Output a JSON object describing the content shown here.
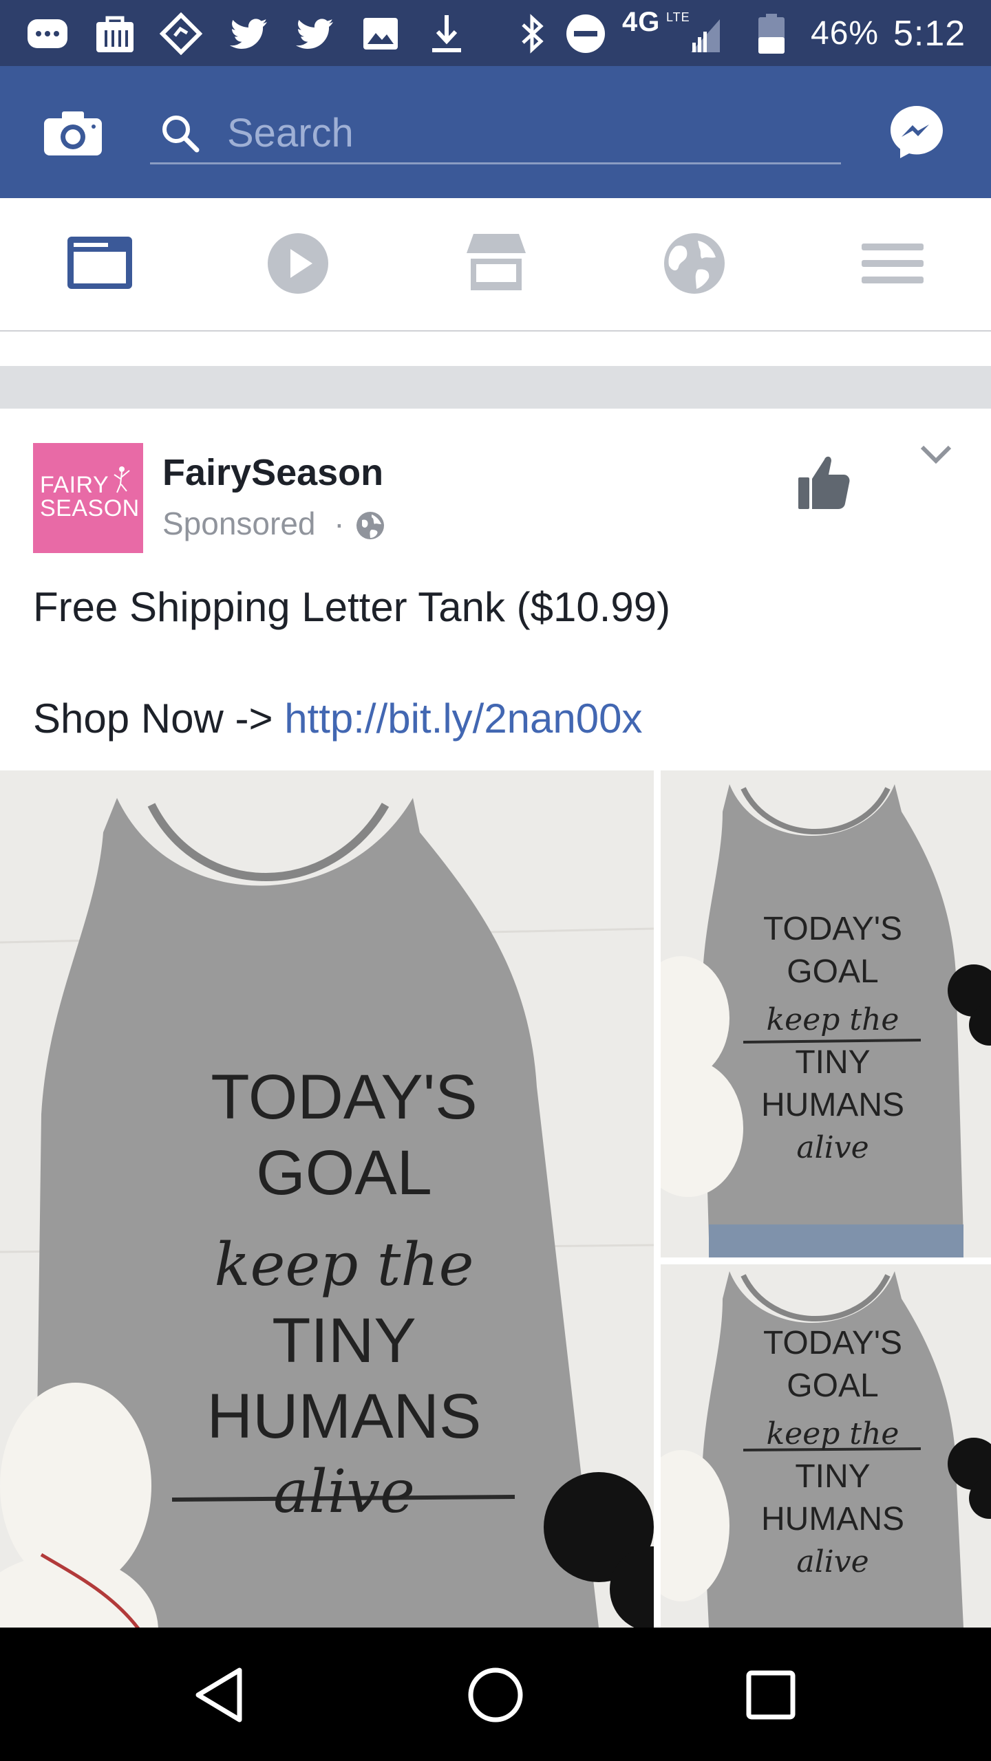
{
  "status_bar": {
    "network": "4G",
    "network_sub": "LTE",
    "battery_percent": "46%",
    "battery_level": 0.46,
    "time": "5:12",
    "left_icons": [
      "chat-icon",
      "shopping-bag-icon",
      "tag-icon",
      "twitter-icon",
      "twitter-icon",
      "image-icon",
      "download-icon"
    ],
    "right_icons": [
      "bluetooth-icon",
      "do-not-disturb-icon",
      "signal-icon",
      "battery-icon"
    ]
  },
  "top_bar": {
    "search_placeholder": "Search",
    "color": "#3b5998"
  },
  "nav_tabs": [
    {
      "name": "news-feed",
      "icon": "news-feed-icon",
      "active": true
    },
    {
      "name": "video",
      "icon": "play-icon",
      "active": false
    },
    {
      "name": "marketplace",
      "icon": "store-icon",
      "active": false
    },
    {
      "name": "notifications",
      "icon": "globe-icon",
      "active": false
    },
    {
      "name": "menu",
      "icon": "hamburger-icon",
      "active": false
    }
  ],
  "post": {
    "avatar_text_line1": "FAIRY",
    "avatar_text_line2": "SEASON",
    "page_name": "FairySeason",
    "sponsored_label": "Sponsored",
    "meta_separator": "·",
    "text_line1": "Free Shipping Letter Tank ($10.99)",
    "text_line2_prefix": "Shop Now ->",
    "link": "http://bit.ly/2nan00x",
    "shirt_print": {
      "line1": "TODAY'S GOAL",
      "line2": "keep the",
      "line3": "TINY HUMANS",
      "line4": "alive"
    }
  },
  "colors": {
    "facebook_blue": "#3b5998",
    "link": "#4267b2",
    "status_bar": "#2e3f6b",
    "avatar_pink": "#e86aa6"
  }
}
